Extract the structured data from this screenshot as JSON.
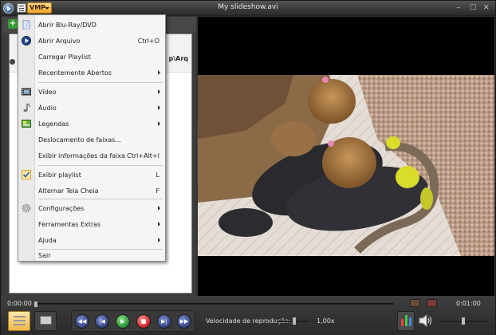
{
  "window": {
    "title": "My slideshow.avi",
    "menu_button_label": "VMP",
    "minimize_glyph": "‒",
    "maximize_glyph": "☐",
    "close_glyph": "✕"
  },
  "playlist": {
    "add_glyph": "+",
    "path_fragment": "p\\Arq",
    "collapse_glyph": "<"
  },
  "menu": {
    "items": [
      {
        "label": "Abrir Blu-Ray/DVD",
        "shortcut": "",
        "submenu": false,
        "icon": "disc-icon"
      },
      {
        "label": "Abrir Arquivo",
        "shortcut": "Ctrl+O",
        "submenu": false,
        "icon": "open-file-icon"
      },
      {
        "label": "Carregar Playlist",
        "shortcut": "",
        "submenu": false,
        "icon": ""
      },
      {
        "label": "Recentemente Abertos",
        "shortcut": "",
        "submenu": true,
        "icon": ""
      },
      {
        "label": "Vídeo",
        "shortcut": "",
        "submenu": true,
        "icon": "film-icon"
      },
      {
        "label": "Áudio",
        "shortcut": "",
        "submenu": true,
        "icon": "music-note-icon"
      },
      {
        "label": "Legendas",
        "shortcut": "",
        "submenu": true,
        "icon": "subtitles-icon"
      },
      {
        "label": "Deslocamento de faixas...",
        "shortcut": "",
        "submenu": false,
        "icon": ""
      },
      {
        "label": "Exibir informações da faixa",
        "shortcut": "Ctrl+Alt+I",
        "submenu": false,
        "icon": ""
      },
      {
        "label": "Exibir playlist",
        "shortcut": "L",
        "submenu": false,
        "icon": "checkmark-icon"
      },
      {
        "label": "Alternar Tela Cheia",
        "shortcut": "F",
        "submenu": false,
        "icon": ""
      },
      {
        "label": "Configurações",
        "shortcut": "",
        "submenu": true,
        "icon": "gear-icon"
      },
      {
        "label": "Ferramentas Extras",
        "shortcut": "",
        "submenu": true,
        "icon": ""
      },
      {
        "label": "Ajuda",
        "shortcut": "",
        "submenu": true,
        "icon": ""
      },
      {
        "label": "Sair",
        "shortcut": "",
        "submenu": false,
        "icon": ""
      }
    ]
  },
  "controls": {
    "time_elapsed": "0:00:00",
    "time_total": "0:01:00",
    "speed_label": "Velocidade de reprodução:",
    "speed_value": "1,00x",
    "seek_progress": 0,
    "volume_level": 0.5
  },
  "colors": {
    "accent": "#f1a72a",
    "play": "#1e8a2a",
    "stop": "#c21a1a",
    "transport": "#2d3a78"
  }
}
